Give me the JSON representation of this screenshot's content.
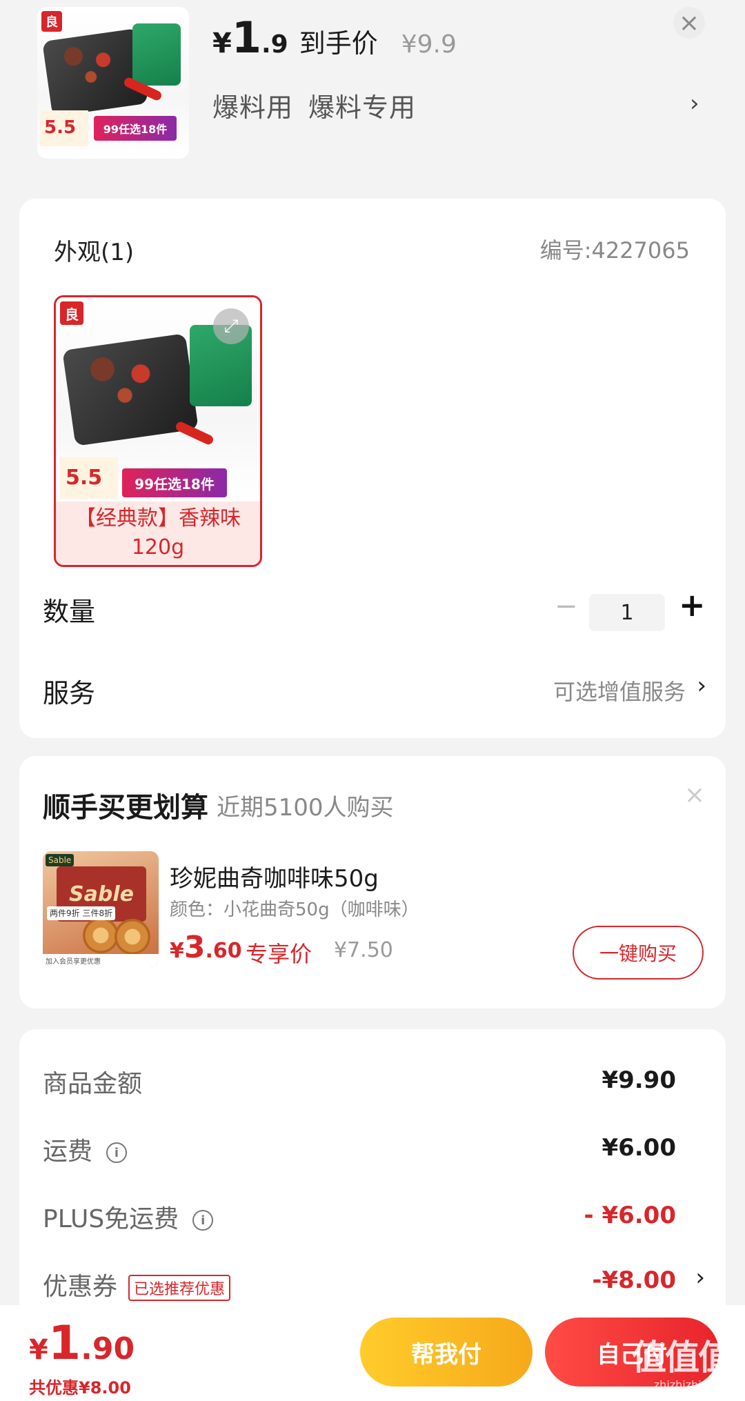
{
  "header": {
    "price_yen": "¥",
    "price_int": "1",
    "price_dec": ".9",
    "price_label": "到手价",
    "original_price": "¥9.9",
    "tags": [
      "爆料用",
      "爆料专用"
    ],
    "close_glyph": "×",
    "chevron_glyph": "›",
    "thumb": {
      "brand": "良",
      "chip_price": "5.5",
      "promo": "99任选18件"
    }
  },
  "spec": {
    "title": "外观(1)",
    "code": "编号:4227065",
    "variant": {
      "label": "【经典款】香辣味120g",
      "brand": "良",
      "chip_price": "5.5",
      "promo": "99任选18件",
      "expand_glyph": "⤢"
    },
    "quantity_label": "数量",
    "quantity_value": "1",
    "minus_glyph": "−",
    "plus_glyph": "+",
    "service_label": "服务",
    "service_value": "可选增值服务",
    "chevron_glyph": "›"
  },
  "addon": {
    "title": "顺手买更划算",
    "subtitle": "近期5100人购买",
    "close_glyph": "×",
    "product_name": "珍妮曲奇咖啡味50g",
    "product_spec": "颜色：小花曲奇50g（咖啡味）",
    "price_yen": "¥",
    "price_int": "3",
    "price_dec": ".60",
    "price_tag": "专享价",
    "original_price": "¥7.50",
    "buy_label": "一键购买",
    "thumb": {
      "box_text": "Sable",
      "badge": "Sable",
      "note": "两件9折 三件8折",
      "foot": "加入会员享更优惠"
    }
  },
  "summary": {
    "rows": [
      {
        "label": "商品金额",
        "value": "¥9.90"
      },
      {
        "label": "运费",
        "value": "¥6.00"
      },
      {
        "label": "PLUS免运费",
        "value": "- ¥6.00"
      },
      {
        "label": "优惠券",
        "value": "-¥8.00",
        "tag": "已选推荐优惠"
      }
    ],
    "info_glyph": "i",
    "chevron_glyph": "›"
  },
  "footer": {
    "total_yen": "¥",
    "total_int": "1",
    "total_dec": ".90",
    "saved_text": "共优惠¥8.00",
    "help_pay_label": "帮我付",
    "self_pay_label": "自己付",
    "watermark": "值值值",
    "watermark_url": "zhizhizhi.com"
  },
  "colors": {
    "accent_red": "#d8262b",
    "help_button": "#f6a91a",
    "background": "#f3f3f3"
  }
}
